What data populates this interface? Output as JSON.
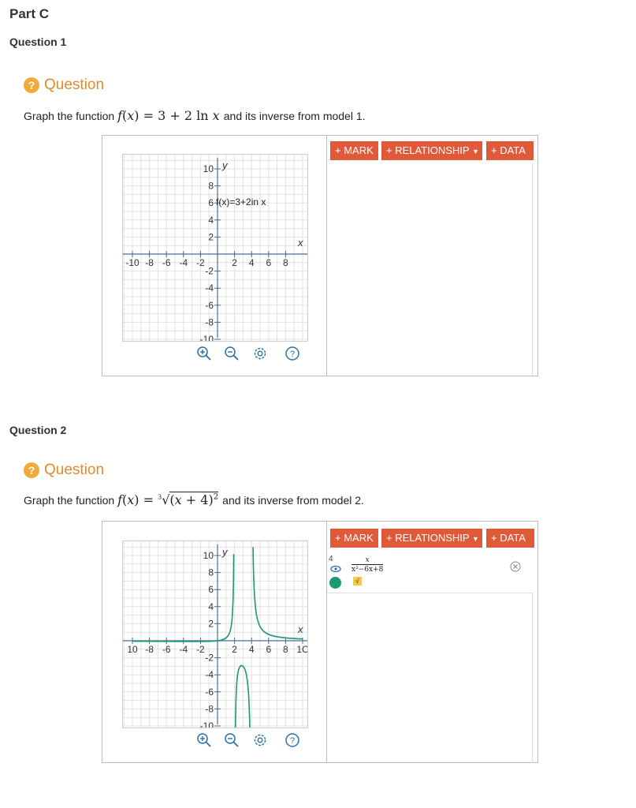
{
  "part_title": "Part C",
  "questions": [
    {
      "heading": "Question 1",
      "label": "Question",
      "badge": "?",
      "prompt_before": "Graph the function",
      "prompt_math": "f(x) = 3 + 2 ln x",
      "prompt_after": "and its inverse from model 1.",
      "toolbar": {
        "mark": "+ MARK",
        "relationship": "+ RELATIONSHIP",
        "data": "+ DATA"
      },
      "graph_label": "f(x)=3+2in x",
      "tools": [
        "zoom-in-icon",
        "zoom-out-icon",
        "gear-icon",
        "help-icon"
      ]
    },
    {
      "heading": "Question 2",
      "label": "Question",
      "badge": "?",
      "prompt_before": "Graph the function",
      "prompt_math": "f(x) = ∛(x + 4)²",
      "prompt_after": "and its inverse from model 2.",
      "toolbar": {
        "mark": "+ MARK",
        "relationship": "+ RELATIONSHIP",
        "data": "+ DATA"
      },
      "relationship_row": {
        "index": "4",
        "numerator": "x",
        "denominator": "x²−6x+8",
        "color": "#1a9a73"
      },
      "tools": [
        "zoom-in-icon",
        "zoom-out-icon",
        "gear-icon",
        "help-icon"
      ]
    }
  ],
  "axes": {
    "x_label": "x",
    "y_label": "y",
    "x_ticks": [
      "-10",
      "-8",
      "-6",
      "-4",
      "-2",
      "2",
      "4",
      "6",
      "8"
    ],
    "y_ticks": [
      "10",
      "8",
      "6",
      "4",
      "2",
      "-2",
      "-4",
      "-6",
      "-8",
      "-10"
    ],
    "x_ticks_2": [
      "10",
      "-8",
      "-6",
      "-4",
      "-2",
      "2",
      "4",
      "6",
      "8",
      "1C"
    ]
  },
  "colors": {
    "accent": "#e05a3a",
    "question": "#e6892b",
    "curve": "#1a9a73"
  }
}
